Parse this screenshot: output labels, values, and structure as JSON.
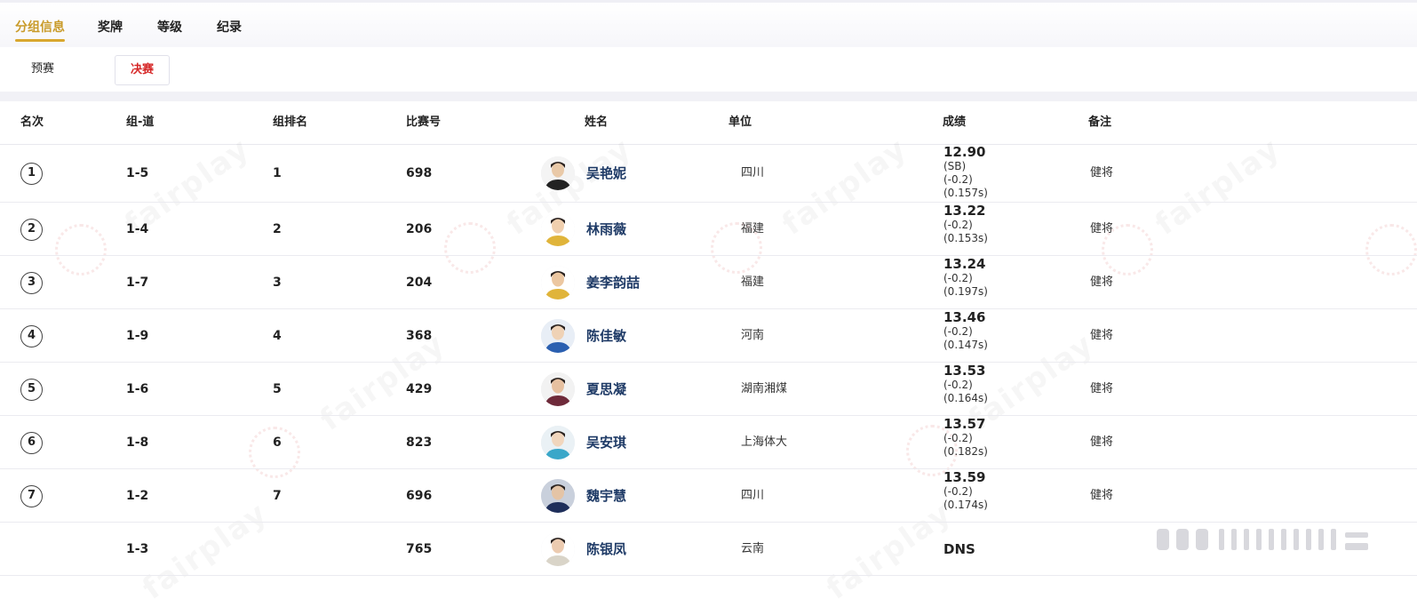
{
  "tabs": [
    {
      "label": "分组信息",
      "active": true
    },
    {
      "label": "奖牌",
      "active": false
    },
    {
      "label": "等级",
      "active": false
    },
    {
      "label": "纪录",
      "active": false
    }
  ],
  "subtabs": [
    {
      "label": "预赛",
      "active": false
    },
    {
      "label": "决赛",
      "active": true
    }
  ],
  "columns": [
    "名次",
    "组-道",
    "组排名",
    "比赛号",
    "姓名",
    "单位",
    "成绩",
    "备注"
  ],
  "rows": [
    {
      "rank": "1",
      "group_lane": "1-5",
      "group_rank": "1",
      "bib": "698",
      "name": "吴艳妮",
      "unit": "四川",
      "time": "12.90",
      "notes": [
        "(SB)",
        "(-0.2)",
        "(0.157s)"
      ],
      "remark": "健将"
    },
    {
      "rank": "2",
      "group_lane": "1-4",
      "group_rank": "2",
      "bib": "206",
      "name": "林雨薇",
      "unit": "福建",
      "time": "13.22",
      "notes": [
        "(-0.2)",
        "(0.153s)"
      ],
      "remark": "健将"
    },
    {
      "rank": "3",
      "group_lane": "1-7",
      "group_rank": "3",
      "bib": "204",
      "name": "姜李韵喆",
      "unit": "福建",
      "time": "13.24",
      "notes": [
        "(-0.2)",
        "(0.197s)"
      ],
      "remark": "健将"
    },
    {
      "rank": "4",
      "group_lane": "1-9",
      "group_rank": "4",
      "bib": "368",
      "name": "陈佳敏",
      "unit": "河南",
      "time": "13.46",
      "notes": [
        "(-0.2)",
        "(0.147s)"
      ],
      "remark": "健将"
    },
    {
      "rank": "5",
      "group_lane": "1-6",
      "group_rank": "5",
      "bib": "429",
      "name": "夏思凝",
      "unit": "湖南湘煤",
      "time": "13.53",
      "notes": [
        "(-0.2)",
        "(0.164s)"
      ],
      "remark": "健将"
    },
    {
      "rank": "6",
      "group_lane": "1-8",
      "group_rank": "6",
      "bib": "823",
      "name": "吴安琪",
      "unit": "上海体大",
      "time": "13.57",
      "notes": [
        "(-0.2)",
        "(0.182s)"
      ],
      "remark": "健将"
    },
    {
      "rank": "7",
      "group_lane": "1-2",
      "group_rank": "7",
      "bib": "696",
      "name": "魏宇慧",
      "unit": "四川",
      "time": "13.59",
      "notes": [
        "(-0.2)",
        "(0.174s)"
      ],
      "remark": "健将"
    },
    {
      "rank": "",
      "group_lane": "1-3",
      "group_rank": "",
      "bib": "765",
      "name": "陈银凤",
      "unit": "云南",
      "time": "DNS",
      "notes": [],
      "remark": ""
    }
  ],
  "colors": {
    "accent": "#d9a72f",
    "active_subtab": "#d62828",
    "name_link": "#1e3a66"
  },
  "icons": {
    "rank": "rank-circle-icon",
    "avatar": "athlete-avatar-icon",
    "more": "ellipsis-icon"
  }
}
